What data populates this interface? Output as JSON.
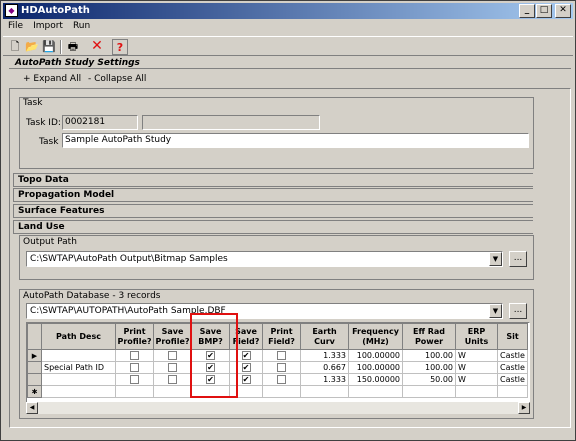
{
  "window": {
    "title": "HDAutoPath",
    "minimize": "_",
    "maximize": "□",
    "close": "✕"
  },
  "menu": {
    "file": "File",
    "import": "Import",
    "run": "Run"
  },
  "settings": {
    "heading": "AutoPath Study Settings",
    "expand_all": "+ Expand All",
    "collapse_all": "- Collapse All"
  },
  "task": {
    "frame_label": "Task",
    "id_label": "Task ID:",
    "id_value": "0002181",
    "id_extra": "",
    "name_label": "Task",
    "name_value": "Sample AutoPath Study"
  },
  "sections": {
    "topo": "Topo Data",
    "propagation": "Propagation Model",
    "surface": "Surface Features",
    "land": "Land Use"
  },
  "output": {
    "frame_label": "Output Path",
    "path": "C:\\SWTAP\\AutoPath Output\\Bitmap Samples",
    "browse": "..."
  },
  "database": {
    "frame_label": "AutoPath Database - 3 records",
    "path": "C:\\SWTAP\\AUTOPATH\\AutoPath Sample.DBF",
    "browse": "..."
  },
  "grid": {
    "headers": [
      "Path Desc",
      "Print Profile?",
      "Save Profile?",
      "Save BMP?",
      "Save Field?",
      "Print Field?",
      "Earth Curv",
      "Frequency (MHz)",
      "Eff Rad Power",
      "ERP Units",
      "Sit"
    ],
    "rows": [
      {
        "marker": "▶",
        "desc": "",
        "print_profile": false,
        "save_profile": false,
        "save_bmp": true,
        "save_field": true,
        "print_field": false,
        "earth": "1.333",
        "freq": "100.00000",
        "erp": "100.00",
        "units": "W",
        "site": "Castle"
      },
      {
        "marker": "",
        "desc": "Special Path ID",
        "print_profile": false,
        "save_profile": false,
        "save_bmp": true,
        "save_field": true,
        "print_field": false,
        "earth": "0.667",
        "freq": "100.00000",
        "erp": "100.00",
        "units": "W",
        "site": "Castle"
      },
      {
        "marker": "",
        "desc": "",
        "print_profile": false,
        "save_profile": false,
        "save_bmp": true,
        "save_field": true,
        "print_field": false,
        "earth": "1.333",
        "freq": "150.00000",
        "erp": "50.00",
        "units": "W",
        "site": "Castle"
      }
    ],
    "new_row_marker": "✱"
  },
  "colors": {
    "titlebar_start": "#0a246a",
    "highlight": "#e01010"
  },
  "icons": [
    "new-icon",
    "open-icon",
    "save-icon",
    "print-icon",
    "delete-icon",
    "help-icon"
  ]
}
